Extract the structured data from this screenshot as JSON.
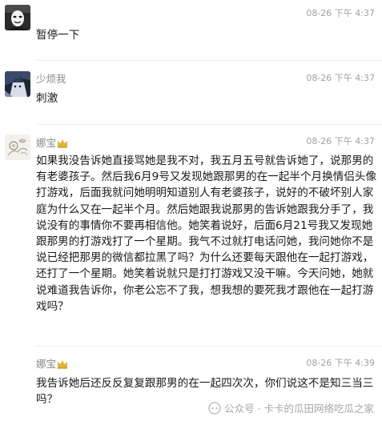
{
  "messages": [
    {
      "name": "",
      "time": "08-26 下午 4:37",
      "text": "暂停一下",
      "avatar_icon": "masked-person-avatar-icon"
    },
    {
      "name": "少烦我",
      "time": "08-26 下午 4:37",
      "text": "刺激",
      "avatar_icon": "anime-character-avatar-icon"
    },
    {
      "name": "娜宝",
      "time": "08-26 下午 4:37",
      "text": "如果我没告诉她直接骂她是我不对，我五月五号就告诉她了，说那男的有老婆孩子。然后我6月9号又发现她跟那男的在一起半个月换情侣头像打游戏，后面我就问她明明知道别人有老婆孩子，说好的不破坏别人家庭为什么又在一起半个月。然后她跟我说那男的告诉她跟我分手了，我说没有的事情你不要再相信他。她笑着说好，后面6月21号我又发现她跟那男的打游戏打了一个星期。我气不过就打电话问她，我问她你不是说已经把那男的微信都拉黑了吗？为什么还要每天跟他在一起打游戏，还打了一个星期。她笑着说就只是打打游戏又没干嘛。今天问她，她就说难道我告诉你，你老公忘不了我，想我想的要死我才跟他在一起打游戏吗？",
      "avatar_icon": "flower-sketch-avatar-icon"
    },
    {
      "name": "娜宝",
      "time": "08-26 下午 4:39",
      "text": "我告诉她后还反反复复跟那男的在一起四次次，你们说这不是知三当三吗？"
    }
  ],
  "watermark": {
    "text": "公众号 · 卡卡的瓜田网络吃瓜之家",
    "icon": "wechat-official-account-icon"
  },
  "colors": {
    "name": "#8a8a8a",
    "time": "#a0a0a0",
    "text": "#1a1a1a",
    "crown": "#e0b43a",
    "divider": "#eeeeee"
  }
}
